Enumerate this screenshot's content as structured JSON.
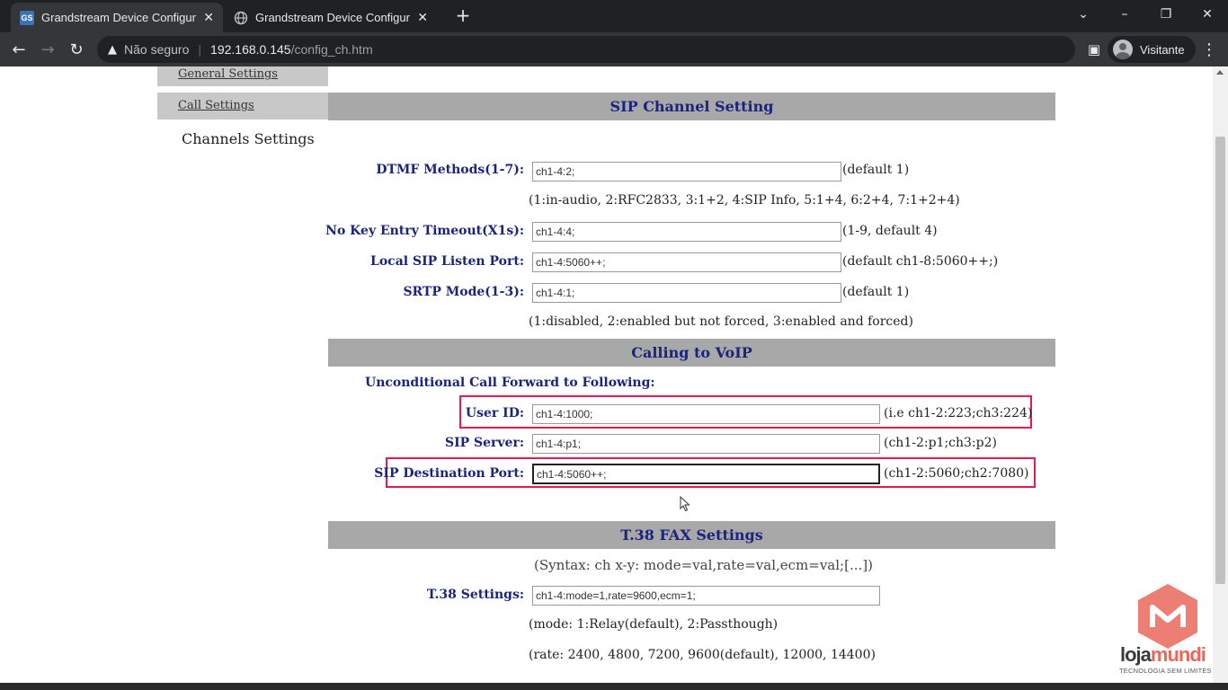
{
  "browser": {
    "tabs": [
      {
        "label": "Grandstream Device Configuratio",
        "favicon": "GS",
        "active": true
      },
      {
        "label": "Grandstream Device Configuratio",
        "active": false
      }
    ],
    "address": {
      "security": "Não seguro",
      "host": "192.168.0.145",
      "path": "/config_ch.htm"
    },
    "profile": "Visitante"
  },
  "sidebar": {
    "items": [
      "General Settings",
      "Call Settings"
    ],
    "section": "Channels Settings"
  },
  "sip_channel": {
    "title": "SIP Channel Setting",
    "dtmf": {
      "label": "DTMF Methods(1-7):",
      "value": "ch1-4:2;",
      "hint": "(default 1)",
      "help": "(1:in-audio, 2:RFC2833, 3:1+2, 4:SIP Info, 5:1+4, 6:2+4, 7:1+2+4)"
    },
    "nokey": {
      "label": "No Key Entry Timeout(X1s):",
      "value": "ch1-4:4;",
      "hint": "(1-9, default 4)"
    },
    "listen_port": {
      "label": "Local SIP Listen Port:",
      "value": "ch1-4:5060++;",
      "hint": "(default ch1-8:5060++;)"
    },
    "srtp": {
      "label": "SRTP Mode(1-3):",
      "value": "ch1-4:1;",
      "hint": "(default 1)",
      "help": "(1:disabled, 2:enabled but not forced, 3:enabled and forced)"
    }
  },
  "voip": {
    "title": "Calling to VoIP",
    "forward_label": "Unconditional Call Forward to Following:",
    "user_id": {
      "label": "User ID:",
      "value": "ch1-4:1000;",
      "hint": "(i.e ch1-2:223;ch3:224)"
    },
    "sip_server": {
      "label": "SIP Server:",
      "value": "ch1-4:p1;",
      "hint": "(ch1-2:p1;ch3:p2)"
    },
    "dest_port": {
      "label": "SIP Destination Port:",
      "value": "ch1-4:5060++;",
      "hint": "(ch1-2:5060;ch2:7080)"
    }
  },
  "t38": {
    "title": "T.38 FAX Settings",
    "syntax": "(Syntax: ch x-y: mode=val,rate=val,ecm=val;[...])",
    "label": "T.38 Settings:",
    "value": "ch1-4:mode=1,rate=9600,ecm=1;",
    "mode_help": "(mode: 1:Relay(default), 2:Passthough)",
    "rate_help": "(rate: 2400, 4800, 7200, 9600(default), 12000, 14400)"
  },
  "watermark": {
    "brand_a": "loja",
    "brand_b": "mundi",
    "tagline": "TECNOLOGIA SEM LIMITES"
  },
  "colors": {
    "highlight": "#e8174c",
    "header_bg": "#a8a8a8",
    "label": "#1a237e"
  }
}
